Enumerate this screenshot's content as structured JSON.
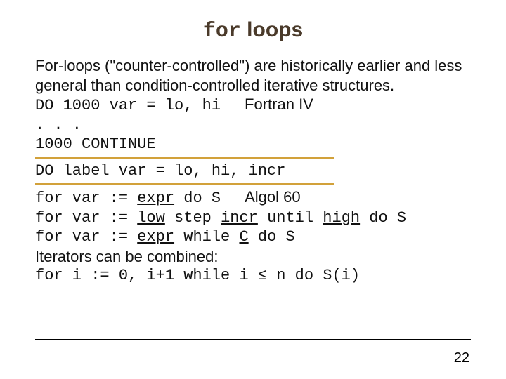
{
  "title": {
    "mono": "for",
    "rest": " loops"
  },
  "intro": "For-loops (\"counter-controlled\") are historically earlier and less general than condition-controlled iterative structures.",
  "fortran": {
    "code1": "DO 1000 var = lo, hi",
    "label": "Fortran IV",
    "dots": ". . .",
    "cont": "1000 CONTINUE",
    "gen": "DO label var = lo, hi, incr"
  },
  "algol": {
    "line1_code": "for var := ",
    "line1_expr": "expr",
    "line1_do": " do S",
    "line1_label": "Algol 60",
    "line2_a": "for var := ",
    "line2_low": "low",
    "line2_step": " step ",
    "line2_incr": "incr",
    "line2_until": " until ",
    "line2_high": "high",
    "line2_do": " do S",
    "line3_a": "for var := ",
    "line3_expr": "expr",
    "line3_while": " while ",
    "line3_C": "C",
    "line3_do": " do S",
    "combine_text": "Iterators can be combined:",
    "line4": "for i := 0, i+1 while i ≤ n do S(i)"
  },
  "page_number": "22"
}
